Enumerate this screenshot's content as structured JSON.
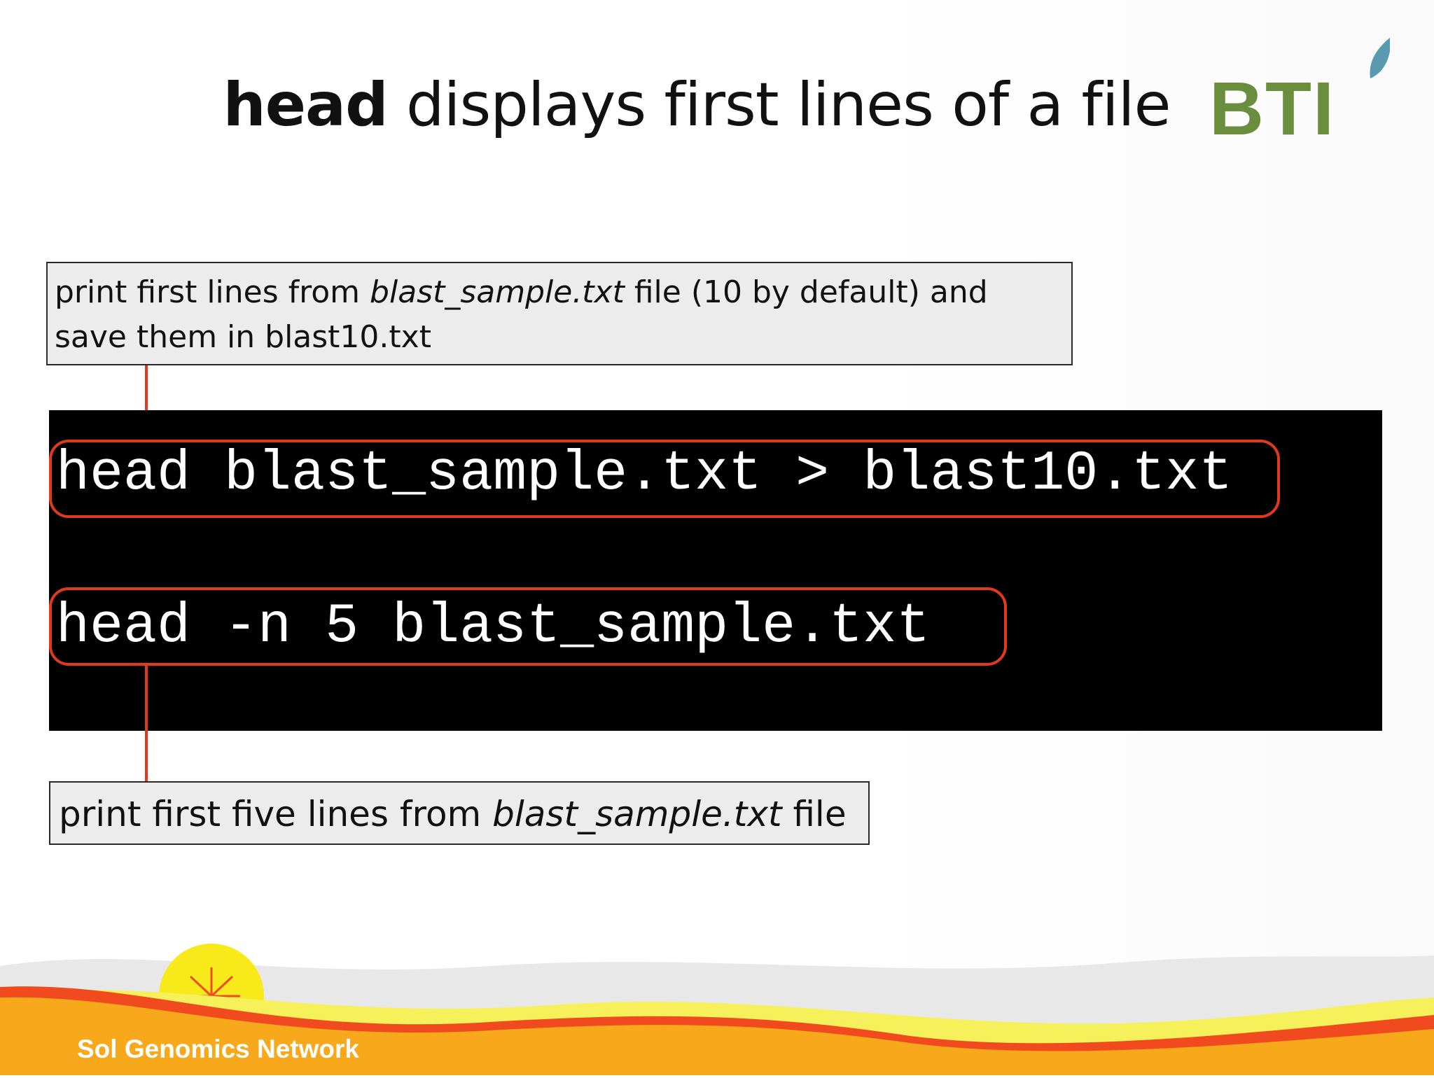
{
  "slide": {
    "title_bold": "head",
    "title_rest": " displays first lines of a file",
    "logo_text": "BTI",
    "callout_top": {
      "text_a": "print first lines from ",
      "text_italic": "blast_sample.txt",
      "text_b": " file (10 by default) and",
      "text_c": "save them in blast10.txt"
    },
    "commands": [
      "head blast_sample.txt > blast10.txt",
      "head -n 5 blast_sample.txt"
    ],
    "callout_bottom": {
      "text_a": "print first five lines from ",
      "text_italic": "blast_sample.txt",
      "text_b": " file"
    },
    "footer": "Sol Genomics Network"
  },
  "colors": {
    "accent_red": "#e03a1e",
    "logo_green": "#6b8e3e",
    "logo_leaf": "#5a9ab0",
    "footer_orange": "#f7a81b",
    "footer_red": "#f04a1e",
    "footer_yellow": "#f6f05a",
    "sun_yellow": "#f8ea1a"
  }
}
